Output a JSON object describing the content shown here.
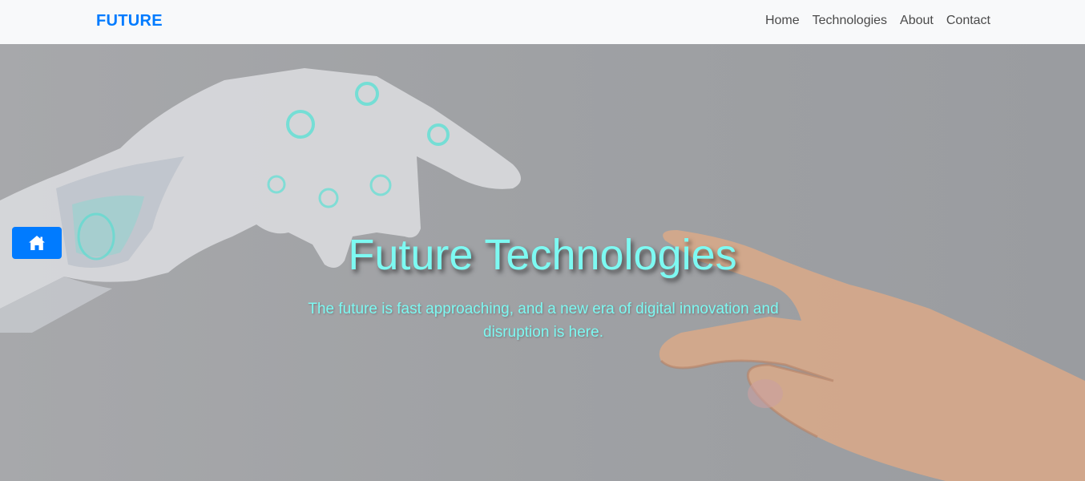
{
  "navbar": {
    "brand": "FUTURE",
    "links": [
      "Home",
      "Technologies",
      "About",
      "Contact"
    ]
  },
  "hero": {
    "title": "Future Technologies",
    "subtitle": "The future is fast approaching, and a new era of digital innovation and disruption is here."
  },
  "floating_button": {
    "icon": "home-icon"
  },
  "colors": {
    "brand": "#007bff",
    "hero_text": "#7df9f2",
    "navbar_bg": "#f8f9fa"
  }
}
